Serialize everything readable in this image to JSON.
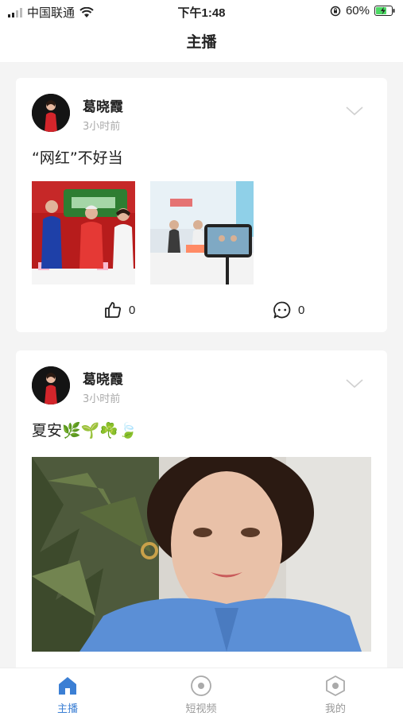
{
  "status": {
    "carrier": "中国联通",
    "time": "下午1:48",
    "battery": "60%"
  },
  "header": {
    "title": "主播"
  },
  "posts": [
    {
      "user": "葛晓霞",
      "time": "3小时前",
      "text": "“网红”不好当",
      "likes": "0",
      "comments": "0"
    },
    {
      "user": "葛晓霞",
      "time": "3小时前",
      "text": "夏安🌿🌱☘️🍃"
    }
  ],
  "tabs": [
    {
      "label": "主播",
      "icon": "home-icon",
      "active": true
    },
    {
      "label": "短视频",
      "icon": "video-circle-icon",
      "active": false
    },
    {
      "label": "我的",
      "icon": "profile-hexagon-icon",
      "active": false
    }
  ],
  "colors": {
    "accent": "#3b7fd4",
    "battery": "#4cd964"
  }
}
